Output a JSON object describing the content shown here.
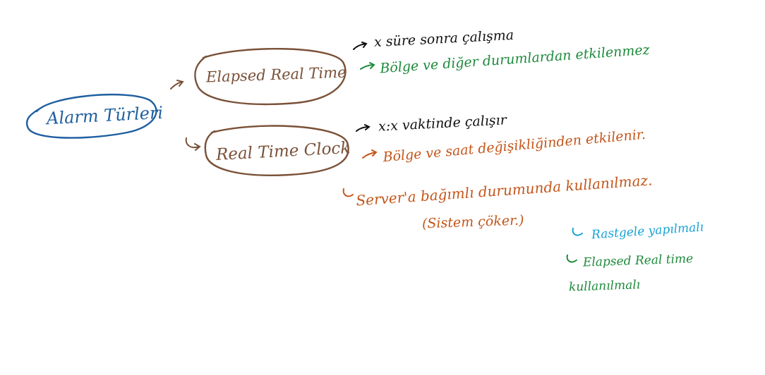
{
  "colors": {
    "root": "#1f5fa0",
    "node": "#7a5138",
    "black": "#111111",
    "green": "#1e8a3c",
    "orange": "#c3561a",
    "cyan": "#1aa3d4"
  },
  "root": {
    "label": "Alarm Türleri"
  },
  "nodes": [
    {
      "label": "Elapsed Real Time",
      "notes": [
        {
          "text": "x süre sonra çalışma",
          "color": "black"
        },
        {
          "text": "Bölge ve diğer durumlardan etkilenmez",
          "color": "green"
        }
      ]
    },
    {
      "label": "Real Time Clock",
      "notes": [
        {
          "text": "x:x vaktinde çalışır",
          "color": "black"
        },
        {
          "text": "Bölge ve saat değişikliğinden etkilenir.",
          "color": "orange"
        },
        {
          "text": "Server'a bağımlı durumunda kullanılmaz.",
          "color": "orange"
        },
        {
          "text": "(Sistem çöker.)",
          "color": "orange"
        }
      ]
    }
  ],
  "side_notes": [
    {
      "text": "Rastgele yapılmalı",
      "color": "cyan"
    },
    {
      "text": "Elapsed Real time",
      "color": "green"
    },
    {
      "text": "kullanılmalı",
      "color": "green"
    }
  ]
}
